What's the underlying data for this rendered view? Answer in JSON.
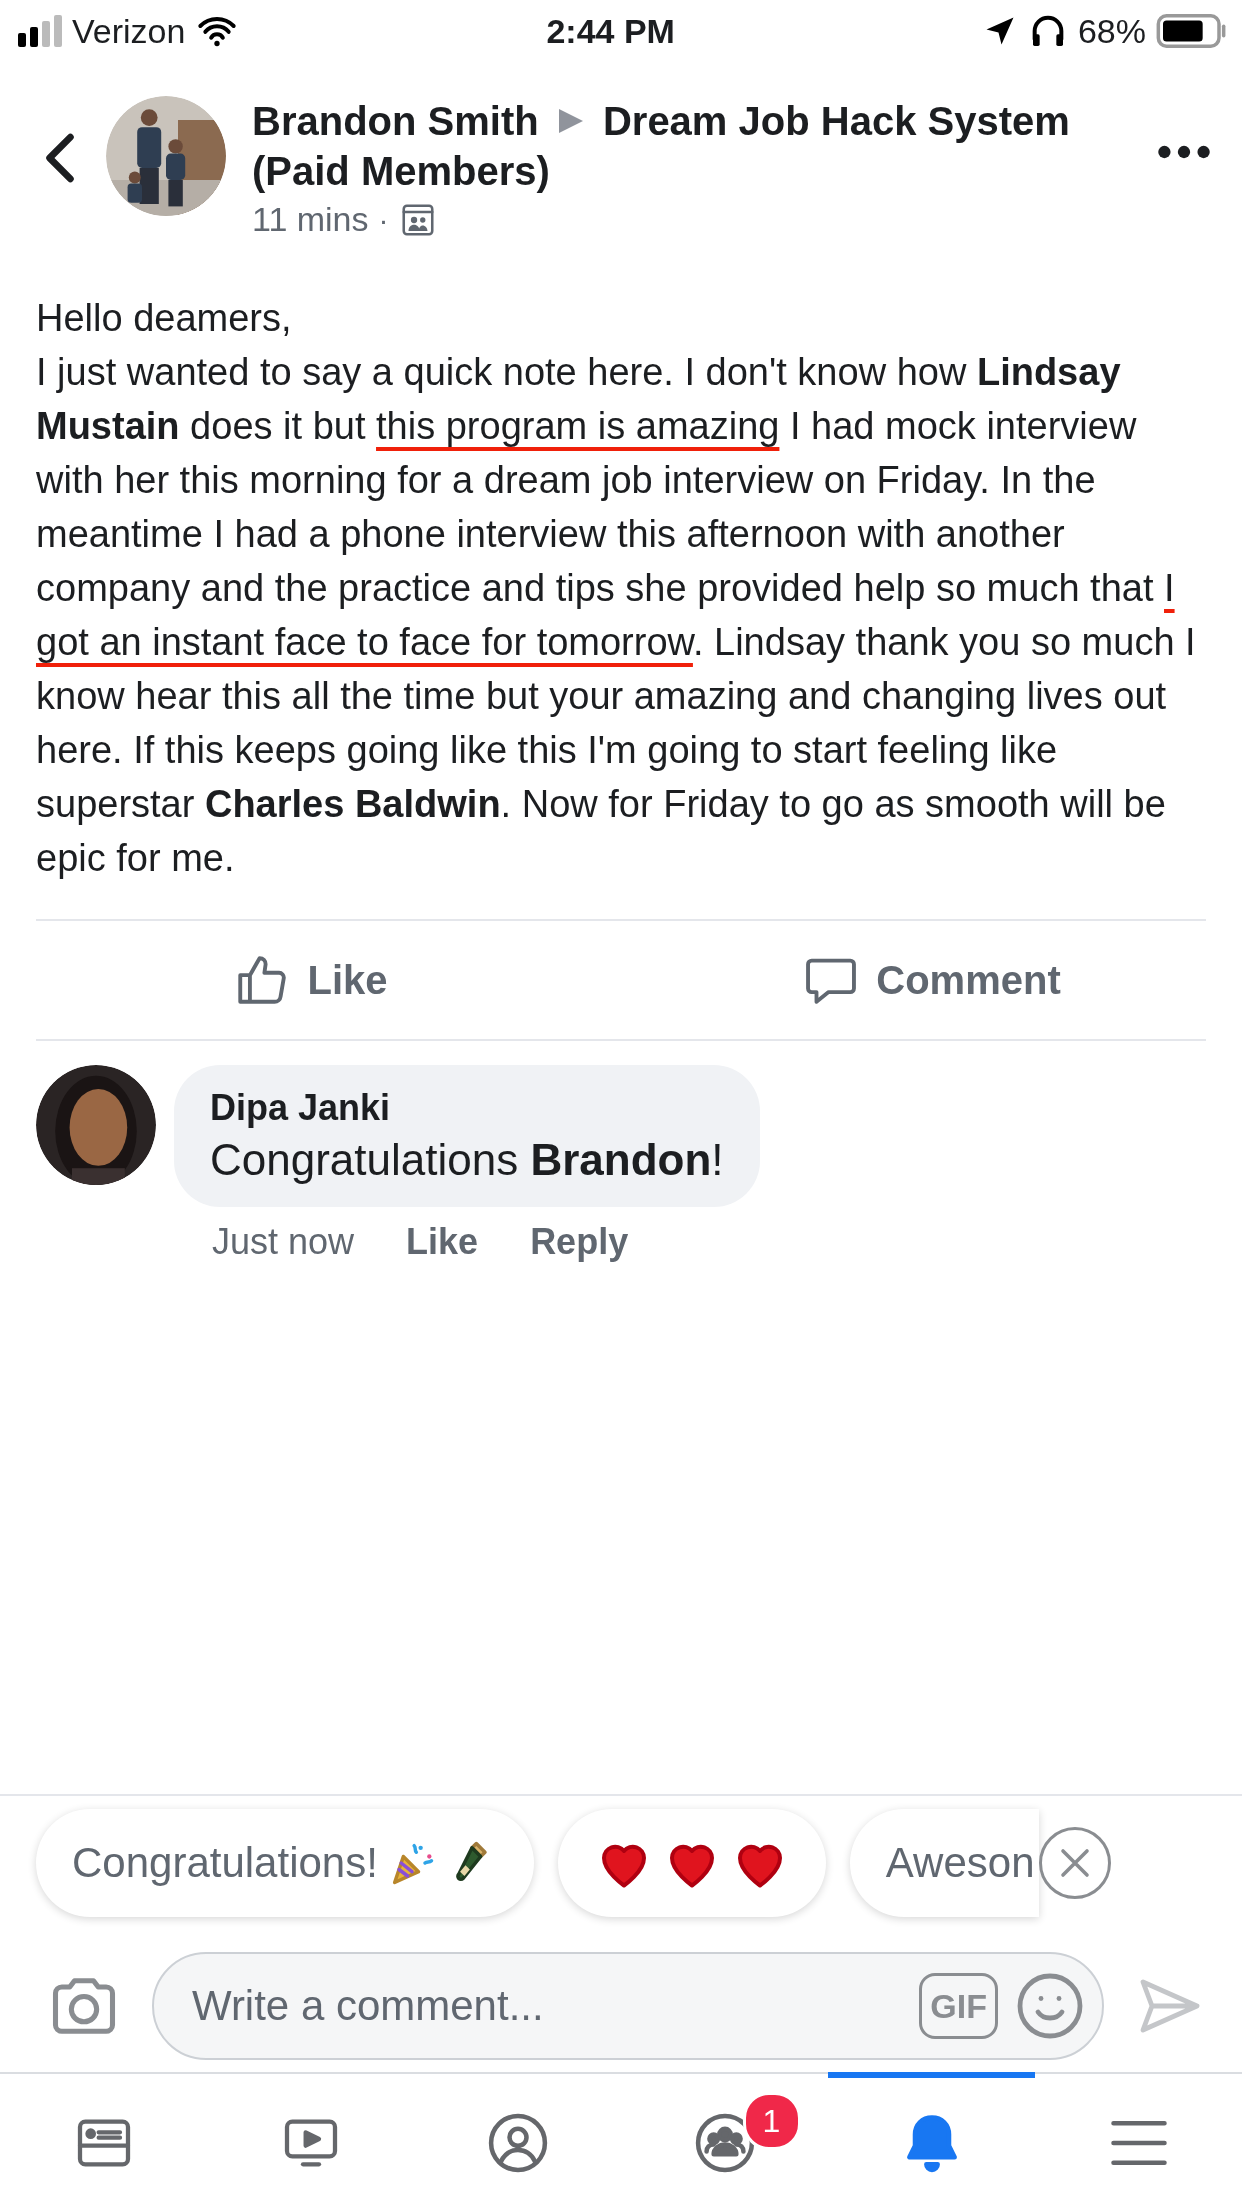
{
  "status_bar": {
    "carrier": "Verizon",
    "time": "2:44 PM",
    "battery": "68%"
  },
  "post": {
    "author": "Brandon Smith",
    "group": "Dream Job Hack System (Paid Members)",
    "time": "11 mins",
    "separator": "·",
    "greeting": "Hello deamers,",
    "body": [
      {
        "kind": "plain",
        "text": "I just wanted to say a quick note here. I don't know how "
      },
      {
        "kind": "bold",
        "text": "Lindsay Mustain"
      },
      {
        "kind": "plain",
        "text": " does it but "
      },
      {
        "kind": "underlined",
        "text": "this program is amazing"
      },
      {
        "kind": "plain",
        "text": " I had mock interview with her this morning for a dream job interview on Friday. In the meantime I had a phone interview this afternoon with another company and the practice and tips she provided help so much that "
      },
      {
        "kind": "underlined",
        "text": "I got an instant face to face for tomorrow"
      },
      {
        "kind": "plain",
        "text": ". Lindsay thank you so much I know hear this all the time but your amazing and changing lives out here. If this keeps going like this I'm going to start feeling like superstar "
      },
      {
        "kind": "bold",
        "text": "Charles Baldwin"
      },
      {
        "kind": "plain",
        "text": ". Now for Friday to go as smooth will be epic for me."
      }
    ],
    "actions": [
      {
        "kind": "like",
        "label": "Like"
      },
      {
        "kind": "comment",
        "label": "Comment"
      }
    ]
  },
  "comments": [
    {
      "author": "Dipa Janki",
      "text": "Congratulations **Brandon**!",
      "time": "Just now",
      "actions": [
        "Like",
        "Reply"
      ]
    }
  ],
  "suggestions": [
    {
      "kind": "congrats",
      "label": "Congratulations!"
    },
    {
      "kind": "hearts"
    },
    {
      "kind": "text",
      "label": "Aweson"
    }
  ],
  "composer": {
    "placeholder": "Write a comment...",
    "gif": "GIF"
  },
  "tab_bar": [
    {
      "kind": "news",
      "selected": false
    },
    {
      "kind": "video",
      "selected": false
    },
    {
      "kind": "profile",
      "selected": false
    },
    {
      "kind": "groups",
      "selected": false,
      "badge": "1"
    },
    {
      "kind": "bell",
      "selected": true
    },
    {
      "kind": "menu",
      "selected": false
    }
  ]
}
